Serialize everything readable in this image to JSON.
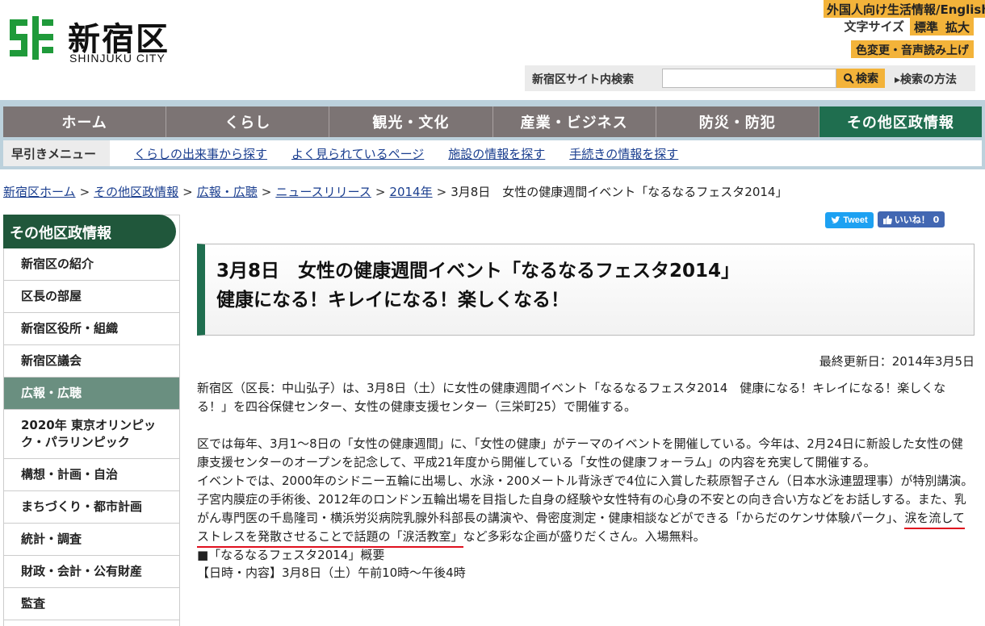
{
  "header": {
    "logo_ja": "新宿区",
    "logo_en": "SHINJUKU CITY",
    "foreign_link": "外国人向け生活情報/English",
    "fontsize_label": "文字サイズ",
    "fontsize_standard": "標準",
    "fontsize_large": "拡大",
    "color_voice": "色変更・音声読み上げ",
    "search_label": "新宿区サイト内検索",
    "search_placeholder": "",
    "search_button": "検索",
    "search_how": "検索の方法"
  },
  "gnav": [
    {
      "label": "ホーム"
    },
    {
      "label": "くらし"
    },
    {
      "label": "観光・文化"
    },
    {
      "label": "産業・ビジネス"
    },
    {
      "label": "防災・防犯"
    },
    {
      "label": "その他区政情報"
    }
  ],
  "quick_menu": {
    "title": "早引きメニュー",
    "links": [
      {
        "label": "くらしの出来事から探す"
      },
      {
        "label": "よく見られているページ"
      },
      {
        "label": "施設の情報を探す"
      },
      {
        "label": "手続きの情報を探す"
      }
    ]
  },
  "breadcrumb": {
    "items": [
      "新宿区ホーム",
      "その他区政情報",
      "広報・広聴",
      "ニュースリリース",
      "2014年"
    ],
    "current": "3月8日　女性の健康週間イベント「なるなるフェスタ2014」",
    "separator": ">"
  },
  "sidebar": {
    "title": "その他区政情報",
    "items": [
      {
        "label": "新宿区の紹介"
      },
      {
        "label": "区長の部屋"
      },
      {
        "label": "新宿区役所・組織"
      },
      {
        "label": "新宿区議会"
      },
      {
        "label": "広報・広聴"
      },
      {
        "label": "2020年 東京オリンピック・パラリンピック"
      },
      {
        "label": "構想・計画・自治"
      },
      {
        "label": "まちづくり・都市計画"
      },
      {
        "label": "統計・調査"
      },
      {
        "label": "財政・会計・公有財産"
      },
      {
        "label": "監査"
      }
    ]
  },
  "social": {
    "tweet": "Tweet",
    "like": "いいね！ 0"
  },
  "article": {
    "title_line1": "3月8日　女性の健康週間イベント「なるなるフェスタ2014」",
    "title_line2": "健康になる！キレイになる！楽しくなる！",
    "updated": "最終更新日：2014年3月5日",
    "p1": "新宿区（区長：中山弘子）は、3月8日（土）に女性の健康週間イベント「なるなるフェスタ2014　健康になる！キレイになる！楽しくなる！」を四谷保健センター、女性の健康支援センター（三栄町25）で開催する。",
    "p2": "区では毎年、3月1～8日の「女性の健康週間」に、「女性の健康」がテーマのイベントを開催している。今年は、2月24日に新設した女性の健康支援センターのオープンを記念して、平成21年度から開催している「女性の健康フォーラム」の内容を充実して開催する。",
    "p3a": "イベントでは、2000年のシドニー五輪に出場し、水泳・200メートル背泳ぎで4位に入賞した萩原智子さん（日本水泳連盟理事）が特別講演。子宮内膜症の手術後、2012年のロンドン五輪出場を目指した自身の経験や女性特有の心身の不安との向き合い方などをお話しする。また、乳がん専門医の千島隆司・横浜労災病院乳腺外科部長の講演や、骨密度測定・健康相談などができる「からだのケンサ体験パーク」、",
    "p3b": "涙を流してストレスを発散させることで話題の「涙活教室」",
    "p3c": "など多彩な企画が盛りだくさん。入場無料。",
    "summary_head": "■「なるなるフェスタ2014」概要",
    "summary_line1": "【日時・内容】3月8日（土）午前10時～午後4時"
  }
}
